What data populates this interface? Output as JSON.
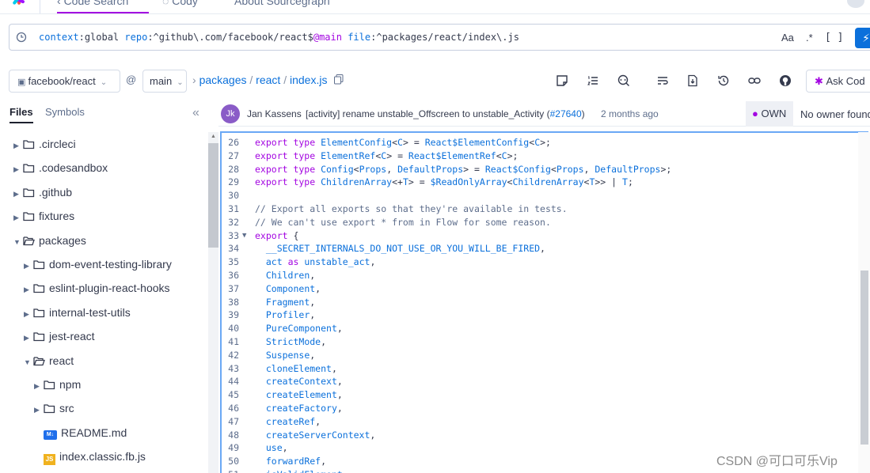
{
  "topnav": {
    "tabs": [
      {
        "label": "Code Search",
        "active": true
      },
      {
        "label": "Cody",
        "active": false
      },
      {
        "label": "About Sourcegraph",
        "active": false
      }
    ]
  },
  "search": {
    "query_parts": {
      "context_key": "context",
      "context_val": "global",
      "repo_key": "repo",
      "repo_val": "^github\\.com/facebook/react$",
      "rev": "@main",
      "file_key": "file",
      "file_val": "^packages/react/index\\.js"
    },
    "case_label": "Aa",
    "regex_label": ".*",
    "structural_label": "[ ]",
    "submit_icon": "lightning-icon"
  },
  "filebar": {
    "repo_label": "facebook/react",
    "at_label": "@",
    "branch_label": "main",
    "breadcrumb": [
      "packages",
      "react",
      "index.js"
    ],
    "ask_label": "Ask Cod"
  },
  "sidebar": {
    "tabs": [
      "Files",
      "Symbols"
    ],
    "active_tab": "Files",
    "collapse_label": "«",
    "tree": [
      {
        "label": ".circleci",
        "kind": "folder",
        "depth": 0,
        "open": false
      },
      {
        "label": ".codesandbox",
        "kind": "folder",
        "depth": 0,
        "open": false
      },
      {
        "label": ".github",
        "kind": "folder",
        "depth": 0,
        "open": false
      },
      {
        "label": "fixtures",
        "kind": "folder",
        "depth": 0,
        "open": false
      },
      {
        "label": "packages",
        "kind": "folder",
        "depth": 0,
        "open": true
      },
      {
        "label": "dom-event-testing-library",
        "kind": "folder",
        "depth": 1,
        "open": false
      },
      {
        "label": "eslint-plugin-react-hooks",
        "kind": "folder",
        "depth": 1,
        "open": false
      },
      {
        "label": "internal-test-utils",
        "kind": "folder",
        "depth": 1,
        "open": false
      },
      {
        "label": "jest-react",
        "kind": "folder",
        "depth": 1,
        "open": false
      },
      {
        "label": "react",
        "kind": "folder",
        "depth": 1,
        "open": true
      },
      {
        "label": "npm",
        "kind": "folder",
        "depth": 2,
        "open": false
      },
      {
        "label": "src",
        "kind": "folder",
        "depth": 2,
        "open": false
      },
      {
        "label": "README.md",
        "kind": "md",
        "depth": 2,
        "badge": "M↓"
      },
      {
        "label": "index.classic.fb.js",
        "kind": "js",
        "depth": 2,
        "badge": "JS"
      }
    ]
  },
  "commit": {
    "avatar_initials": "Jk",
    "author": "Jan Kassens",
    "message": "[activity] rename unstable_Offscreen to unstable_Activity (",
    "pr": "#27640",
    "message_end": ")",
    "ago": "2 months ago",
    "own_label": "OWN",
    "owner_text": "No owner found"
  },
  "code": {
    "lines": [
      {
        "n": "26",
        "t": [
          [
            "kw",
            "export type "
          ],
          [
            "ty",
            "ElementConfig"
          ],
          [
            "pn",
            "<"
          ],
          [
            "ty",
            "C"
          ],
          [
            "pn",
            "> = "
          ],
          [
            "ty",
            "React$ElementConfig"
          ],
          [
            "pn",
            "<"
          ],
          [
            "ty",
            "C"
          ],
          [
            "pn",
            ">;"
          ]
        ]
      },
      {
        "n": "27",
        "t": [
          [
            "kw",
            "export type "
          ],
          [
            "ty",
            "ElementRef"
          ],
          [
            "pn",
            "<"
          ],
          [
            "ty",
            "C"
          ],
          [
            "pn",
            "> = "
          ],
          [
            "ty",
            "React$ElementRef"
          ],
          [
            "pn",
            "<"
          ],
          [
            "ty",
            "C"
          ],
          [
            "pn",
            ">;"
          ]
        ]
      },
      {
        "n": "28",
        "t": [
          [
            "kw",
            "export type "
          ],
          [
            "ty",
            "Config"
          ],
          [
            "pn",
            "<"
          ],
          [
            "ty",
            "Props"
          ],
          [
            "pn",
            ", "
          ],
          [
            "ty",
            "DefaultProps"
          ],
          [
            "pn",
            "> = "
          ],
          [
            "ty",
            "React$Config"
          ],
          [
            "pn",
            "<"
          ],
          [
            "ty",
            "Props"
          ],
          [
            "pn",
            ", "
          ],
          [
            "ty",
            "DefaultProps"
          ],
          [
            "pn",
            ">;"
          ]
        ]
      },
      {
        "n": "29",
        "t": [
          [
            "kw",
            "export type "
          ],
          [
            "ty",
            "ChildrenArray"
          ],
          [
            "pn",
            "<+"
          ],
          [
            "ty",
            "T"
          ],
          [
            "pn",
            "> = "
          ],
          [
            "ty",
            "$ReadOnlyArray"
          ],
          [
            "pn",
            "<"
          ],
          [
            "ty",
            "ChildrenArray"
          ],
          [
            "pn",
            "<"
          ],
          [
            "ty",
            "T"
          ],
          [
            "pn",
            ">> | "
          ],
          [
            "ty",
            "T"
          ],
          [
            "pn",
            ";"
          ]
        ]
      },
      {
        "n": "30",
        "t": []
      },
      {
        "n": "31",
        "t": [
          [
            "cm",
            "// Export all exports so that they're available in tests."
          ]
        ]
      },
      {
        "n": "32",
        "t": [
          [
            "cm",
            "// We can't use export * from in Flow for some reason."
          ]
        ]
      },
      {
        "n": "33",
        "fold": true,
        "t": [
          [
            "kw",
            "export "
          ],
          [
            "pn",
            "{"
          ]
        ]
      },
      {
        "n": "34",
        "t": [
          [
            "pn",
            "  "
          ],
          [
            "id",
            "__SECRET_INTERNALS_DO_NOT_USE_OR_YOU_WILL_BE_FIRED"
          ],
          [
            "pn",
            ","
          ]
        ]
      },
      {
        "n": "35",
        "t": [
          [
            "pn",
            "  "
          ],
          [
            "id",
            "act "
          ],
          [
            "kw",
            "as "
          ],
          [
            "id",
            "unstable_act"
          ],
          [
            "pn",
            ","
          ]
        ]
      },
      {
        "n": "36",
        "t": [
          [
            "pn",
            "  "
          ],
          [
            "id",
            "Children"
          ],
          [
            "pn",
            ","
          ]
        ]
      },
      {
        "n": "37",
        "t": [
          [
            "pn",
            "  "
          ],
          [
            "id",
            "Component"
          ],
          [
            "pn",
            ","
          ]
        ]
      },
      {
        "n": "38",
        "t": [
          [
            "pn",
            "  "
          ],
          [
            "id",
            "Fragment"
          ],
          [
            "pn",
            ","
          ]
        ]
      },
      {
        "n": "39",
        "t": [
          [
            "pn",
            "  "
          ],
          [
            "id",
            "Profiler"
          ],
          [
            "pn",
            ","
          ]
        ]
      },
      {
        "n": "40",
        "t": [
          [
            "pn",
            "  "
          ],
          [
            "id",
            "PureComponent"
          ],
          [
            "pn",
            ","
          ]
        ]
      },
      {
        "n": "41",
        "t": [
          [
            "pn",
            "  "
          ],
          [
            "id",
            "StrictMode"
          ],
          [
            "pn",
            ","
          ]
        ]
      },
      {
        "n": "42",
        "t": [
          [
            "pn",
            "  "
          ],
          [
            "id",
            "Suspense"
          ],
          [
            "pn",
            ","
          ]
        ]
      },
      {
        "n": "43",
        "t": [
          [
            "pn",
            "  "
          ],
          [
            "id",
            "cloneElement"
          ],
          [
            "pn",
            ","
          ]
        ]
      },
      {
        "n": "44",
        "t": [
          [
            "pn",
            "  "
          ],
          [
            "id",
            "createContext"
          ],
          [
            "pn",
            ","
          ]
        ]
      },
      {
        "n": "45",
        "t": [
          [
            "pn",
            "  "
          ],
          [
            "id",
            "createElement"
          ],
          [
            "pn",
            ","
          ]
        ]
      },
      {
        "n": "46",
        "t": [
          [
            "pn",
            "  "
          ],
          [
            "id",
            "createFactory"
          ],
          [
            "pn",
            ","
          ]
        ]
      },
      {
        "n": "47",
        "t": [
          [
            "pn",
            "  "
          ],
          [
            "id",
            "createRef"
          ],
          [
            "pn",
            ","
          ]
        ]
      },
      {
        "n": "48",
        "t": [
          [
            "pn",
            "  "
          ],
          [
            "id",
            "createServerContext"
          ],
          [
            "pn",
            ","
          ]
        ]
      },
      {
        "n": "49",
        "t": [
          [
            "pn",
            "  "
          ],
          [
            "id",
            "use"
          ],
          [
            "pn",
            ","
          ]
        ]
      },
      {
        "n": "50",
        "t": [
          [
            "pn",
            "  "
          ],
          [
            "id",
            "forwardRef"
          ],
          [
            "pn",
            ","
          ]
        ]
      },
      {
        "n": "51",
        "t": [
          [
            "pn",
            "  "
          ],
          [
            "id",
            "isValidElement"
          ],
          [
            "pn",
            ","
          ]
        ]
      }
    ]
  },
  "watermark": "CSDN @可口可乐Vip",
  "colors": {
    "accent_blue": "#0b70db",
    "accent_purple": "#a305e1",
    "focus_border": "#6aa8f5"
  }
}
